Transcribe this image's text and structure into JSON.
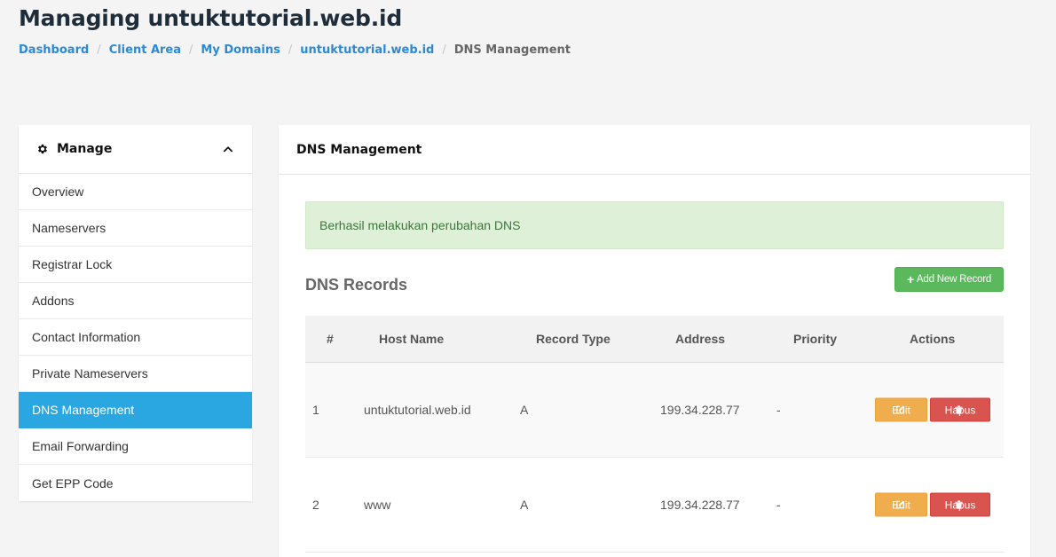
{
  "page": {
    "title": "Managing untuktutorial.web.id"
  },
  "breadcrumb": [
    {
      "label": "Dashboard"
    },
    {
      "label": "Client Area"
    },
    {
      "label": "My Domains"
    },
    {
      "label": "untuktutorial.web.id"
    },
    {
      "label": "DNS Management"
    }
  ],
  "sidebar": {
    "title": "Manage",
    "items": [
      {
        "label": "Overview"
      },
      {
        "label": "Nameservers"
      },
      {
        "label": "Registrar Lock"
      },
      {
        "label": "Addons"
      },
      {
        "label": "Contact Information"
      },
      {
        "label": "Private Nameservers"
      },
      {
        "label": "DNS Management"
      },
      {
        "label": "Email Forwarding"
      },
      {
        "label": "Get EPP Code"
      }
    ],
    "active_index": 6
  },
  "panel": {
    "title": "DNS Management",
    "alert": "Berhasil melakukan perubahan DNS",
    "records_title": "DNS Records",
    "add_button": "Add New Record"
  },
  "table": {
    "headers": {
      "num": "#",
      "host": "Host Name",
      "type": "Record Type",
      "address": "Address",
      "priority": "Priority",
      "actions": "Actions"
    },
    "rows": [
      {
        "num": "1",
        "host": "untuktutorial.web.id",
        "type": "A",
        "address": "199.34.228.77",
        "priority": "-"
      },
      {
        "num": "2",
        "host": "www",
        "type": "A",
        "address": "199.34.228.77",
        "priority": "-"
      }
    ],
    "edit_label": "Edit",
    "delete_label": "Hapus"
  },
  "colors": {
    "link": "#2b8ad8",
    "active": "#2aa7e1",
    "success": "#5cb85c",
    "warning": "#f0ad4e",
    "danger": "#d9534f"
  },
  "icons": {
    "sidebar": "gear-icon",
    "collapse": "chevron-up-icon",
    "add": "plus-icon",
    "edit": "edit-icon",
    "delete": "trash-icon"
  }
}
